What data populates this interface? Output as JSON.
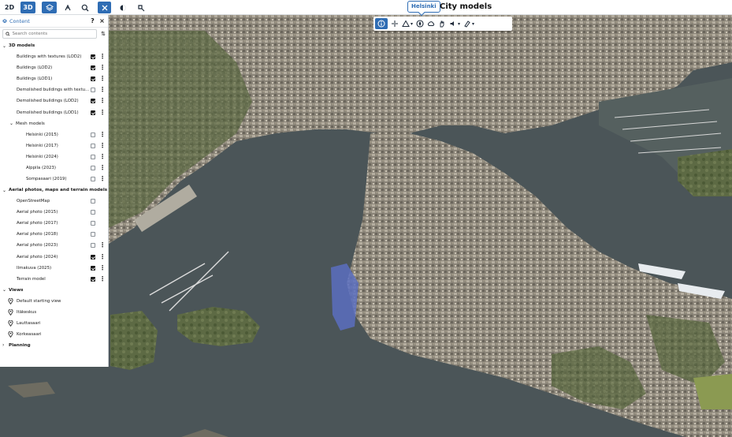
{
  "topbar": {
    "btn_2d": "2D",
    "btn_3d": "3D",
    "brand": "Helsinki",
    "title": "City models"
  },
  "panel": {
    "title": "Content",
    "help": "?",
    "close": "×",
    "search_placeholder": "Search contents",
    "sections": {
      "models": "3D models",
      "mesh": "Mesh models",
      "aerial": "Aerial photos, maps and terrain models",
      "views": "Views",
      "planning": "Planning"
    },
    "models": [
      {
        "label": "Buildings with textures (LOD2)",
        "checked": true,
        "menu": true
      },
      {
        "label": "Buildings (LOD2)",
        "checked": true,
        "menu": true
      },
      {
        "label": "Buildings (LOD1)",
        "checked": true,
        "menu": true
      },
      {
        "label": "Demolished buildings with textures...",
        "checked": false,
        "menu": true
      },
      {
        "label": "Demolished buildings (LOD2)",
        "checked": true,
        "menu": true
      },
      {
        "label": "Demolished buildings (LOD1)",
        "checked": true,
        "menu": true
      }
    ],
    "mesh": [
      {
        "label": "Helsinki (2015)",
        "checked": false,
        "menu": true
      },
      {
        "label": "Helsinki (2017)",
        "checked": false,
        "menu": true
      },
      {
        "label": "Helsinki (2024)",
        "checked": false,
        "menu": true
      },
      {
        "label": "Alppila (2023)",
        "checked": false,
        "menu": true
      },
      {
        "label": "Sompasaari (2019)",
        "checked": false,
        "menu": true
      }
    ],
    "aerial": [
      {
        "label": "OpenStreetMap",
        "checked": false,
        "menu": false
      },
      {
        "label": "Aerial photo (2015)",
        "checked": false,
        "menu": false
      },
      {
        "label": "Aerial photo (2017)",
        "checked": false,
        "menu": false
      },
      {
        "label": "Aerial photo (2018)",
        "checked": false,
        "menu": false
      },
      {
        "label": "Aerial photo (2023)",
        "checked": false,
        "menu": true
      },
      {
        "label": "Aerial photo (2024)",
        "checked": true,
        "menu": true
      },
      {
        "label": "Ilmakuva (2025)",
        "checked": true,
        "menu": true
      },
      {
        "label": "Terrain model",
        "checked": true,
        "menu": true
      }
    ],
    "views": [
      {
        "label": "Default starting view"
      },
      {
        "label": "Itäkeskus"
      },
      {
        "label": "Lauttasaari"
      },
      {
        "label": "Korkeasaari"
      }
    ]
  },
  "colors": {
    "accent": "#2f6db4",
    "water": "#4d5759",
    "land": "#7d7a6e"
  },
  "icons": {
    "layers": "layers-icon",
    "measure": "measure-icon",
    "search_area": "search-area-icon",
    "tools": "tools-icon",
    "info": "info-icon"
  }
}
